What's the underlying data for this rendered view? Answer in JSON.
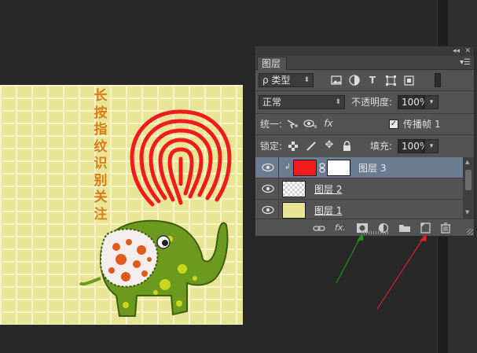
{
  "canvas_text": "长按指纹识别关注",
  "panel": {
    "tab_label": "图层",
    "filter": {
      "label": "ρ 类型"
    },
    "blend_mode": "正常",
    "opacity_label": "不透明度:",
    "opacity_value": "100%",
    "unify_label": "统一:",
    "propagate_label": "传播帧",
    "propagate_value": "1",
    "lock_label": "锁定:",
    "fill_label": "填充:",
    "fill_value": "100%",
    "layers": [
      {
        "name": "图层 3",
        "selected": true
      },
      {
        "name": "图层 2",
        "selected": false
      },
      {
        "name": "图层 1",
        "selected": false
      }
    ]
  },
  "colors": {
    "background": "#282828",
    "panel": "#535353",
    "selected_layer": "#6a7b92",
    "fingerprint_red": "#ee1c1c",
    "annotation_green": "#1e8f1e",
    "annotation_red": "#d8202a"
  }
}
